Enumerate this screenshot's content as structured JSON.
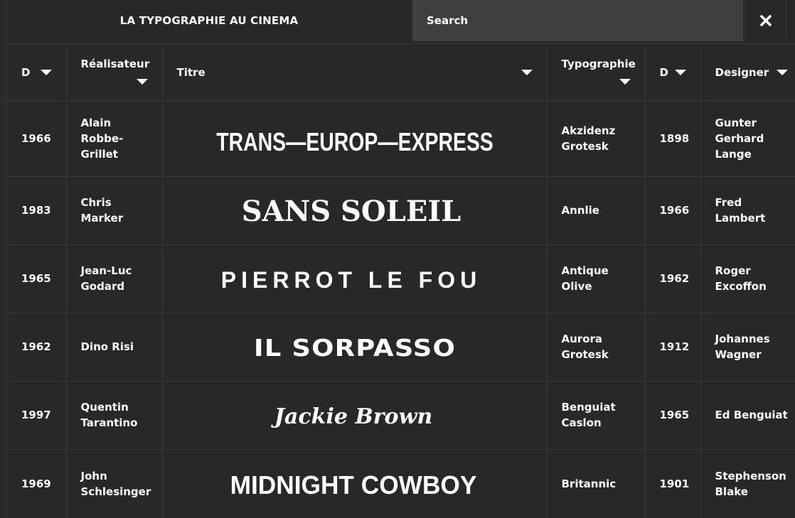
{
  "header": {
    "site_title": "LA TYPOGRAPHIE AU CINEMA",
    "search_placeholder": "Search",
    "close_symbol": "✖"
  },
  "columns": [
    {
      "key": "year",
      "label": "D",
      "sortable": true
    },
    {
      "key": "director",
      "label": "Réalisateur",
      "sortable": true
    },
    {
      "key": "title",
      "label": "Titre",
      "sortable": true
    },
    {
      "key": "typeface",
      "label": "Typographie",
      "sortable": true
    },
    {
      "key": "type_year",
      "label": "D",
      "sortable": true
    },
    {
      "key": "designer",
      "label": "Designer",
      "sortable": true
    }
  ],
  "rows": [
    {
      "year": "1966",
      "director": "Alain Robbe-Grillet",
      "title": "TRANS—EUROP—EXPRESS",
      "title_style": "condensed",
      "typeface": "Akzidenz Grotesk",
      "type_year": "1898",
      "designer": "Gunter Gerhard Lange"
    },
    {
      "year": "1983",
      "director": "Chris Marker",
      "title": "SANS SOLEIL",
      "title_style": "serif-bold",
      "typeface": "Annlie",
      "type_year": "1966",
      "designer": "Fred Lambert"
    },
    {
      "year": "1965",
      "director": "Jean-Luc Godard",
      "title": "PIERROT LE FOU",
      "title_style": "wide-spaced",
      "typeface": "Antique Olive",
      "type_year": "1962",
      "designer": "Roger Excoffon"
    },
    {
      "year": "1962",
      "director": "Dino Risi",
      "title": "IL SORPASSO",
      "title_style": "extended-black",
      "typeface": "Aurora Grotesk",
      "type_year": "1912",
      "designer": "Johannes Wagner"
    },
    {
      "year": "1997",
      "director": "Quentin Tarantino",
      "title": "Jackie Brown",
      "title_style": "retro-script",
      "typeface": "Benguiat Caslon",
      "type_year": "1965",
      "designer": "Ed Benguiat"
    },
    {
      "year": "1969",
      "director": "John Schlesinger",
      "title": "MIDNIGHT COWBOY",
      "title_style": "bold-sans",
      "typeface": "Britannic",
      "type_year": "1901",
      "designer": "Stephenson Blake"
    }
  ]
}
